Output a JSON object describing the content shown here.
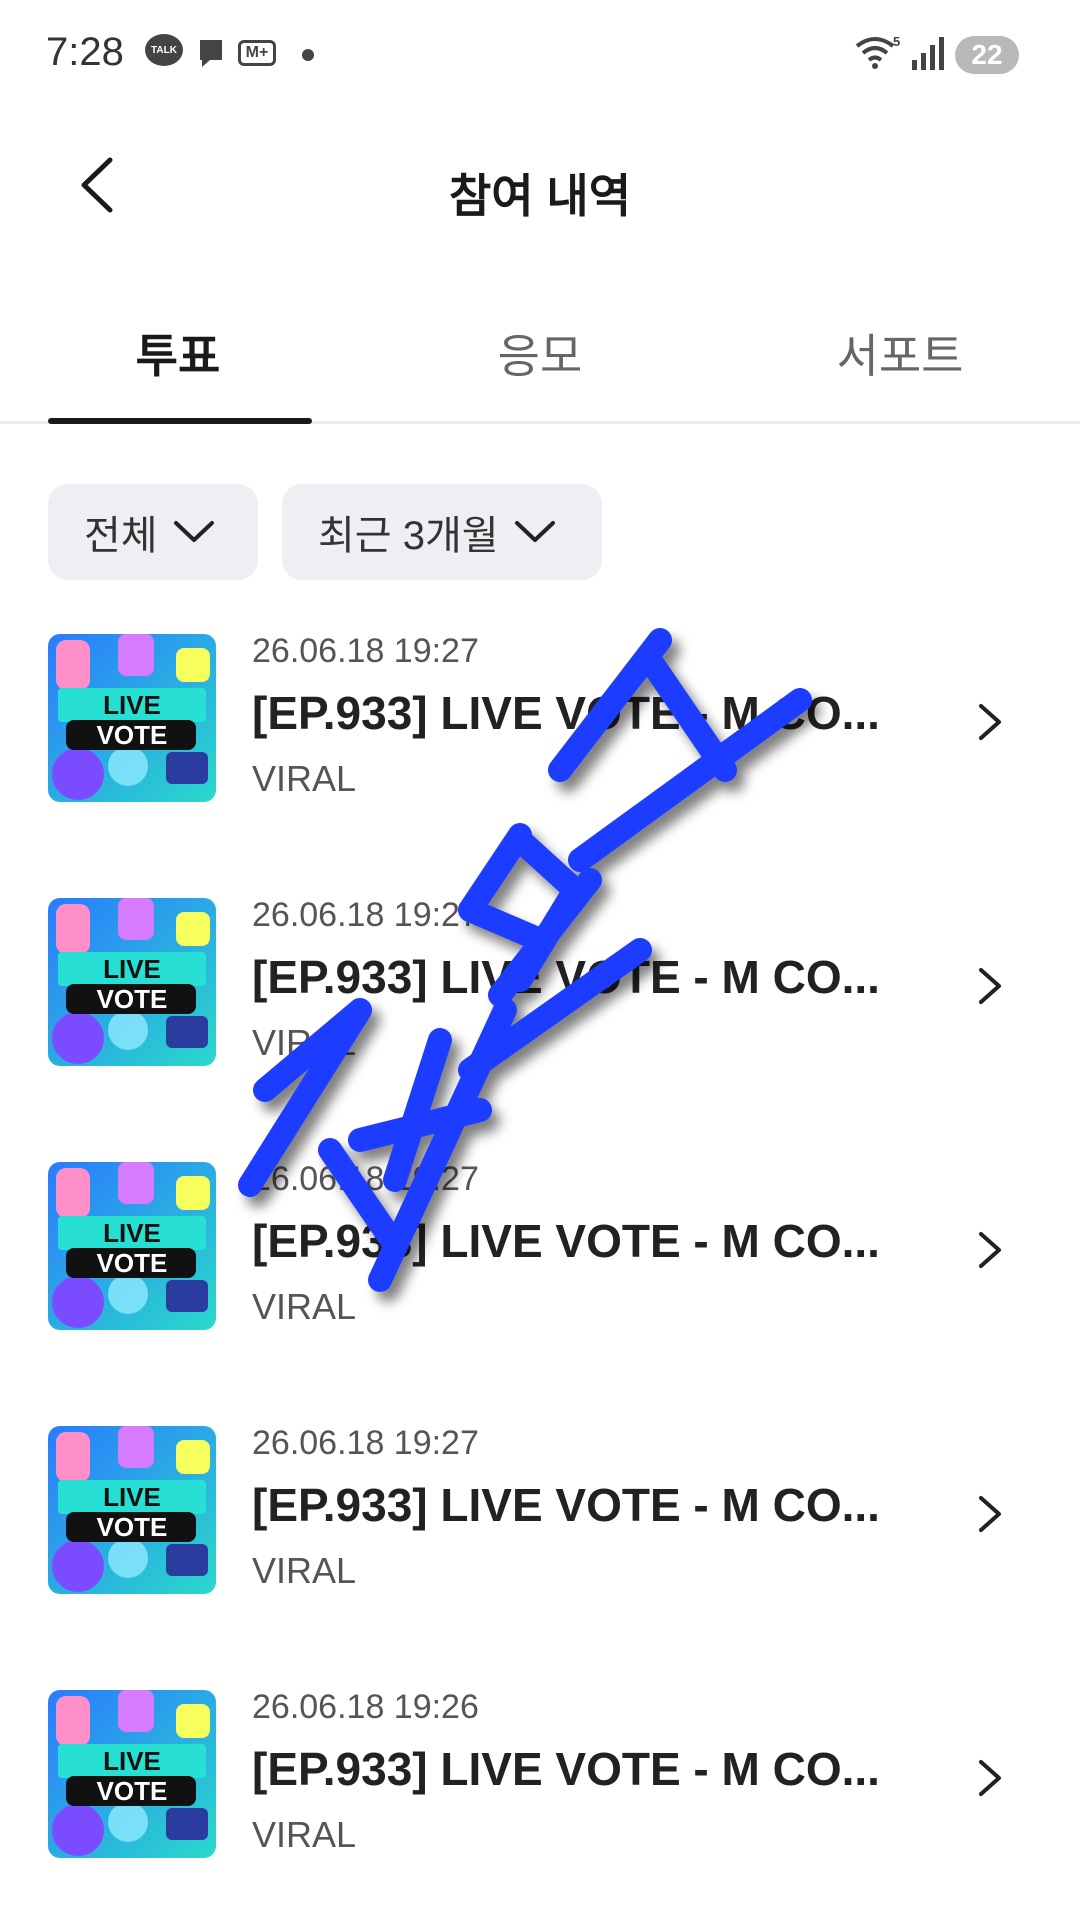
{
  "status_bar": {
    "time": "7:28",
    "talk_label": "TALK",
    "mnet_label": "M+",
    "battery": "22"
  },
  "header": {
    "title": "참여 내역",
    "back_icon": "chevron-left-icon"
  },
  "tabs": [
    {
      "label": "투표",
      "active": true
    },
    {
      "label": "응모",
      "active": false
    },
    {
      "label": "서포트",
      "active": false
    }
  ],
  "filters": [
    {
      "label": "전체"
    },
    {
      "label": "최근 3개월"
    }
  ],
  "items": [
    {
      "date": "26.06.18 19:27",
      "title": "[EP.933] LIVE VOTE - M CO...",
      "subtitle": "VIRAL",
      "thumb_line1": "LIVE",
      "thumb_line2": "VOTE"
    },
    {
      "date": "26.06.18 19:27",
      "title": "[EP.933] LIVE VOTE - M CO...",
      "subtitle": "VIRAL",
      "thumb_line1": "LIVE",
      "thumb_line2": "VOTE"
    },
    {
      "date": "26.06.18 19:27",
      "title": "[EP.933] LIVE VOTE - M CO...",
      "subtitle": "VIRAL",
      "thumb_line1": "LIVE",
      "thumb_line2": "VOTE"
    },
    {
      "date": "26.06.18 19:27",
      "title": "[EP.933] LIVE VOTE - M CO...",
      "subtitle": "VIRAL",
      "thumb_line1": "LIVE",
      "thumb_line2": "VOTE"
    },
    {
      "date": "26.06.18 19:26",
      "title": "[EP.933] LIVE VOTE - M CO...",
      "subtitle": "VIRAL",
      "thumb_line1": "LIVE",
      "thumb_line2": "VOTE"
    }
  ],
  "watermark": {
    "text": "제로스",
    "color": "#1f3cff"
  }
}
